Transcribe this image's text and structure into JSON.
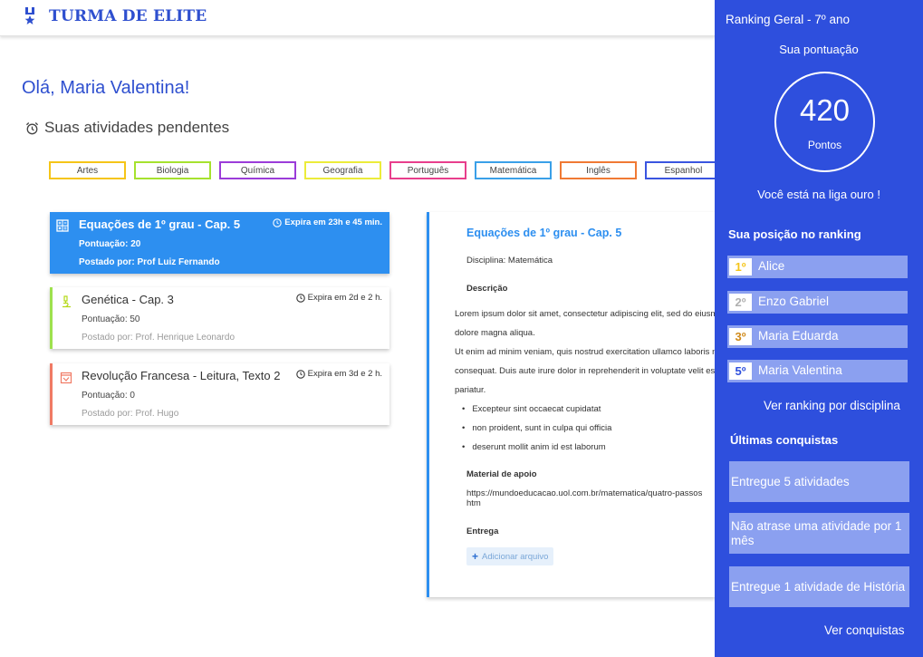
{
  "header": {
    "brand": "TURMA DE ELITE",
    "logo_icon": "medal-icon"
  },
  "greeting": "Olá, Maria Valentina!",
  "pending_title": "Suas atividades pendentes",
  "filters": [
    {
      "label": "Artes",
      "color": "#f5c518"
    },
    {
      "label": "Biologia",
      "color": "#a6e22e"
    },
    {
      "label": "Química",
      "color": "#9b3cd9"
    },
    {
      "label": "Geografia",
      "color": "#ecec3a"
    },
    {
      "label": "Português",
      "color": "#e83e8c"
    },
    {
      "label": "Matemática",
      "color": "#3aa0e8"
    },
    {
      "label": "Inglês",
      "color": "#f07a34"
    },
    {
      "label": "Espanhol",
      "color": "#3a55e0"
    }
  ],
  "activities": [
    {
      "title": "Equações de 1º grau - Cap. 5",
      "expires": "Expira em 23h e 45 min.",
      "score": "Pontuação: 20",
      "posted": "Postado por: Prof Luiz Fernando",
      "icon": "calculator-icon"
    },
    {
      "title": "Genética - Cap. 3",
      "expires": "Expira em 2d e 2 h.",
      "score": "Pontuação: 50",
      "posted": "Postado por: Prof. Henrique Leonardo",
      "icon": "microscope-icon"
    },
    {
      "title": "Revolução Francesa - Leitura, Texto 2",
      "expires": "Expira em 3d e 2 h.",
      "score": "Pontuação: 0",
      "posted": "Postado por: Prof. Hugo",
      "icon": "history-book-icon"
    }
  ],
  "detail": {
    "title": "Equações de 1º grau - Cap. 5",
    "discipline": "Disciplina: Matemática",
    "desc_heading": "Descrição",
    "desc_lines": [
      "Lorem ipsum dolor sit amet, consectetur adipiscing elit, sed do eiusmod tempor",
      "dolore magna aliqua.",
      "Ut enim ad minim veniam, quis nostrud exercitation ullamco laboris nisi ut",
      "consequat. Duis aute irure dolor in reprehenderit in voluptate velit esse",
      "pariatur."
    ],
    "bullets": [
      "Excepteur sint occaecat cupidatat",
      "non proident, sunt in culpa qui officia",
      "deserunt mollit anim id est laborum"
    ],
    "material_heading": "Material de apoio",
    "material_link_line1": "https://mundoeducacao.uol.com.br/matematica/quatro-passos",
    "material_link_line2": "htm",
    "delivery_heading": "Entrega",
    "add_file": "Adicionar arquivo"
  },
  "sidebar": {
    "title": "Ranking Geral  - 7º ano",
    "score_label": "Sua pontuação",
    "points": "420",
    "points_label": "Pontos",
    "league": "Você está na liga ouro !",
    "position_heading": "Sua posição no ranking",
    "ranking": [
      {
        "pos": "1º",
        "name": "Alice",
        "color": "#f5c518"
      },
      {
        "pos": "2º",
        "name": "Enzo Gabriel",
        "color": "#b0b0b0"
      },
      {
        "pos": "3º",
        "name": "Maria Eduarda",
        "color": "#d08a1a"
      },
      {
        "pos": "5º",
        "name": "Maria Valentina",
        "color": "#2e4fdd"
      }
    ],
    "ranking_link": "Ver ranking por disciplina",
    "achievements_heading": "Últimas conquistas",
    "achievements": [
      "Entregue 5 atividades",
      "Não atrase uma atividade por 1 mês",
      "Entregue 1 atividade de História"
    ],
    "achievements_link": "Ver conquistas"
  }
}
